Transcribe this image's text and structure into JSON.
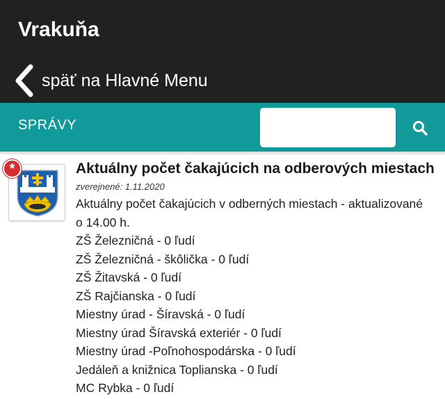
{
  "header": {
    "title": "Vrakuňa",
    "back_label": "späť na Hlavné Menu"
  },
  "newsbar": {
    "section_label": "SPRÁVY",
    "search_value": "",
    "search_placeholder": ""
  },
  "icons": {
    "back": "chevron-left-icon",
    "search": "search-icon",
    "badge": "asterisk-icon",
    "thumbnail": "coat-of-arms"
  },
  "colors": {
    "topbar": "#212121",
    "accent": "#109a9a",
    "badge": "#d32f2f"
  },
  "article": {
    "badge": "*",
    "title": "Aktuálny počet čakajúcich na odberových miestach",
    "published_prefix": "zverejnené:",
    "published_date": "1.11.2020",
    "lines": [
      "Aktuálny počet čakajúcich v odberných miestach - aktualizované",
      "o 14.00 h.",
      "ZŠ Železničná - 0 ľudí",
      "ZŠ Železničná - škôlička - 0 ľudí",
      "ZŠ Žitavská - 0 ľudí",
      "ZŠ Rajčianska - 0 ľudí",
      "Miestny úrad - Šíravská - 0 ľudí",
      "Miestny úrad Šíravská exteriér - 0 ľudí",
      "Miestny úrad -Poľnohospodárska - 0 ľudí",
      "Jedáleň a knižnica Toplianska - 0 ľudí",
      "MC Rybka - 0 ľudí"
    ]
  }
}
